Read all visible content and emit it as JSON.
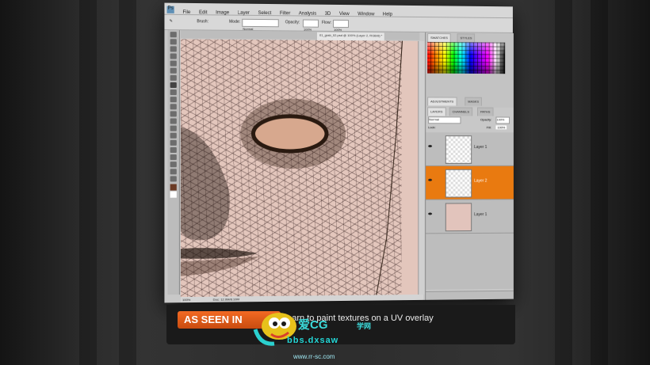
{
  "menu": [
    "File",
    "Edit",
    "Image",
    "Layer",
    "Select",
    "Filter",
    "Analysis",
    "3D",
    "View",
    "Window",
    "Help"
  ],
  "options": {
    "tool_label": "Brush:",
    "mode_label": "Mode:",
    "mode_value": "Normal",
    "opacity_label": "Opacity:",
    "opacity_value": "100%",
    "flow_label": "Flow:",
    "flow_value": "100%"
  },
  "doc_tabs": [
    "01_grab_02.psd @ 100% (Layer 2, RGB/8) *"
  ],
  "status": {
    "zoom": "100%",
    "doc": "Doc: 12.0M/8.10M"
  },
  "panels": {
    "swatches_tab": "SWATCHES",
    "styles_tab": "STYLES",
    "adjust_tab": "ADJUSTMENTS",
    "masks_tab": "MASKS",
    "layers_tab": "LAYERS",
    "channels_tab": "CHANNELS",
    "paths_tab": "PATHS"
  },
  "layers_panel": {
    "blend": "Normal",
    "opacity_label": "Opacity:",
    "opacity_value": "100%",
    "lock_label": "Lock:",
    "fill_label": "Fill:",
    "fill_value": "100%"
  },
  "layers": [
    {
      "name": "Layer 1"
    },
    {
      "name": "Layer 2"
    },
    {
      "name": "Layer 1"
    }
  ],
  "banner": {
    "seen": "AS SEEN IN",
    "text": "Learn to paint textures on a UV overlay"
  },
  "watermark": {
    "cn": "爱CG",
    "cn2": "学网",
    "line1": "bbs.dxsaw",
    "line2": "www.rr-sc.com"
  }
}
